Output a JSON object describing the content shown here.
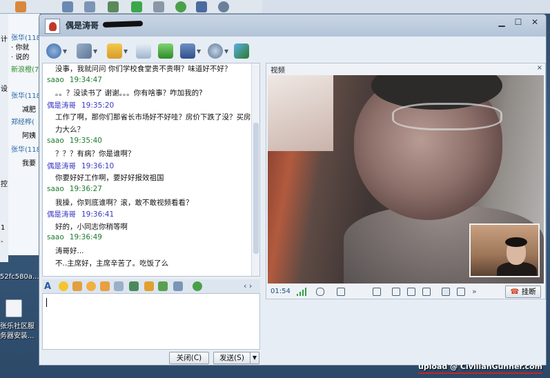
{
  "window": {
    "title": "偶是涛哥",
    "controls": [
      "▁",
      "☐",
      "✕"
    ]
  },
  "background": {
    "contacts": [
      {
        "name": "张华(118"
      },
      {
        "line": "· 你就"
      },
      {
        "line": "· 说的"
      },
      {
        "name": "新浪橙(7"
      },
      {
        "name": "张华(118"
      },
      {
        "line": "减肥"
      },
      {
        "name": "郑经桦("
      },
      {
        "line": "阿姨"
      },
      {
        "name": "张华(118"
      },
      {
        "line": "我要"
      }
    ],
    "left_strip_labels": [
      "计",
      "设",
      "控",
      "1",
      "-"
    ],
    "desktop_labels": [
      "52fc580a...",
      "张乐社区服",
      "务器安装..."
    ]
  },
  "chat": {
    "messages": [
      {
        "type": "text",
        "text": "没事，我就问问 你们学校食堂贵不贵啊？味道好不好？"
      },
      {
        "type": "header",
        "who": "self",
        "sender": "saao",
        "time": "19:34:47"
      },
      {
        "type": "text",
        "text": "。。？没读书了 谢谢。。。你有啥事？咋加我的?"
      },
      {
        "type": "header",
        "who": "other",
        "sender": "偶是涛哥",
        "time": "19:35:20"
      },
      {
        "type": "text",
        "text": "工作了啊，那你们那省长市场好不好哇？房价下跌了没？买房压"
      },
      {
        "type": "text",
        "text": "力大么？"
      },
      {
        "type": "header",
        "who": "self",
        "sender": "saao",
        "time": "19:35:40"
      },
      {
        "type": "text",
        "text": "？？？有病？你是谁啊？"
      },
      {
        "type": "header",
        "who": "other",
        "sender": "偶是涛哥",
        "time": "19:36:10"
      },
      {
        "type": "text",
        "text": "你要好好工作啊，要好好报效祖国"
      },
      {
        "type": "header",
        "who": "self",
        "sender": "saao",
        "time": "19:36:27"
      },
      {
        "type": "text",
        "text": "我操，你到底谁啊？滚，敢不敢视频看看？"
      },
      {
        "type": "header",
        "who": "other",
        "sender": "偶是涛哥",
        "time": "19:36:41"
      },
      {
        "type": "text",
        "text": "好的，小同志你稍等啊"
      },
      {
        "type": "header",
        "who": "self",
        "sender": "saao",
        "time": "19:36:49"
      },
      {
        "type": "text",
        "text": "涛哥好..."
      },
      {
        "type": "text",
        "text": "不..主席好，主席辛苦了。吃饭了么"
      }
    ]
  },
  "buttons": {
    "close": "关闭(C)",
    "send": "发送(S)",
    "send_arrow": "▼"
  },
  "video": {
    "panel_title": "视频",
    "close": "×",
    "timer": "01:54",
    "hangup": "挂断",
    "more": "»"
  },
  "watermark": "upload @ CivilianGunner.com",
  "colors": {
    "self_sender": "#1d7b2e",
    "other_sender": "#3838c4",
    "accent": "#2a4a7a"
  }
}
